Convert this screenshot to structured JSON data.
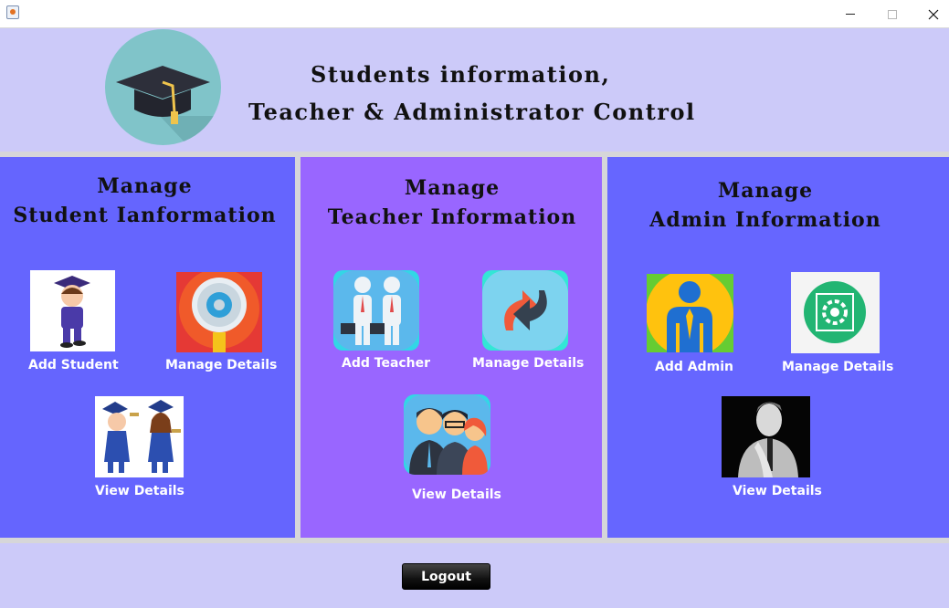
{
  "window": {
    "title": ""
  },
  "header": {
    "title_line1": "Students information,",
    "title_line2": "Teacher & Administrator Control"
  },
  "student_panel": {
    "title_line1": "Manage",
    "title_line2": "Student Ianformation",
    "add_label": "Add Student",
    "manage_label": "Manage Details",
    "view_label": "View Details"
  },
  "teacher_panel": {
    "title_line1": "Manage",
    "title_line2": "Teacher Information",
    "add_label": "Add Teacher",
    "manage_label": "Manage Details",
    "view_label": "View Details"
  },
  "admin_panel": {
    "title_line1": "Manage",
    "title_line2": "Admin Information",
    "add_label": "Add Admin",
    "manage_label": "Manage Details",
    "view_label": "View Details"
  },
  "footer": {
    "logout_label": "Logout"
  },
  "colors": {
    "background": "#cccaf9",
    "student_panel": "#6565fe",
    "teacher_panel": "#9966ff",
    "admin_panel": "#6666ff",
    "logo_circle": "#80c4c9"
  },
  "icons": {
    "logo": "graduation-cap-icon",
    "add_student": "student-graduate-icon",
    "student_manage": "magnifier-gear-icon",
    "student_view": "graduates-icon",
    "add_teacher": "teachers-icon",
    "teacher_manage": "refresh-arrows-icon",
    "teacher_view": "people-group-icon",
    "add_admin": "admin-person-icon",
    "admin_manage": "settings-gear-icon",
    "admin_view": "admin-portrait-icon"
  }
}
